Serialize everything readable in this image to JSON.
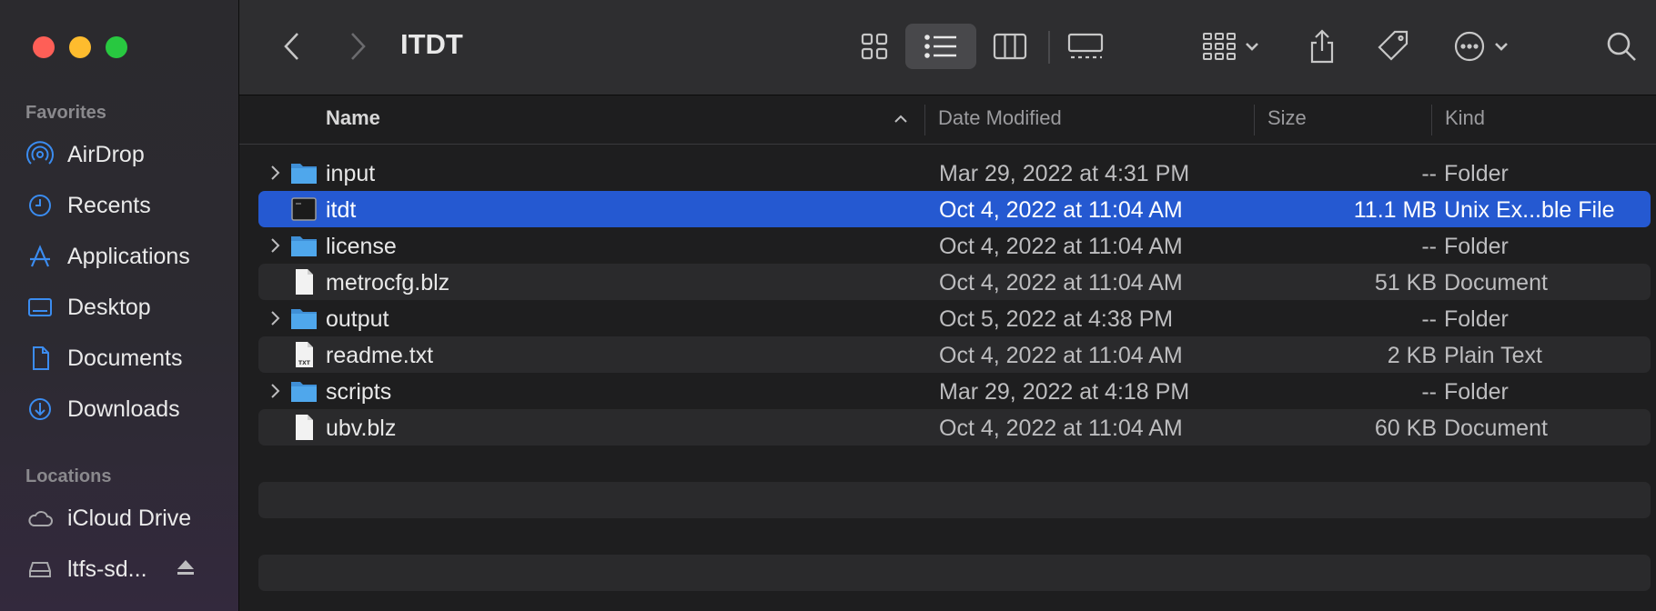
{
  "window": {
    "title": "ITDT"
  },
  "sidebar": {
    "favorites_heading": "Favorites",
    "favorites": [
      {
        "label": "AirDrop",
        "icon": "airdrop-icon"
      },
      {
        "label": "Recents",
        "icon": "clock-icon"
      },
      {
        "label": "Applications",
        "icon": "applications-icon"
      },
      {
        "label": "Desktop",
        "icon": "desktop-icon"
      },
      {
        "label": "Documents",
        "icon": "document-icon"
      },
      {
        "label": "Downloads",
        "icon": "download-icon"
      }
    ],
    "locations_heading": "Locations",
    "locations": [
      {
        "label": "iCloud Drive",
        "icon": "cloud-icon"
      },
      {
        "label": "ltfs-sd...",
        "icon": "drive-icon",
        "ejectable": true
      }
    ]
  },
  "columns": {
    "name": "Name",
    "date": "Date Modified",
    "size": "Size",
    "kind": "Kind"
  },
  "files": [
    {
      "name": "input",
      "date": "Mar 29, 2022 at 4:31 PM",
      "size": "--",
      "kind": "Folder",
      "type": "folder"
    },
    {
      "name": "itdt",
      "date": "Oct 4, 2022 at 11:04 AM",
      "size": "11.1 MB",
      "kind": "Unix Ex...ble File",
      "type": "exec",
      "selected": true
    },
    {
      "name": "license",
      "date": "Oct 4, 2022 at 11:04 AM",
      "size": "--",
      "kind": "Folder",
      "type": "folder"
    },
    {
      "name": "metrocfg.blz",
      "date": "Oct 4, 2022 at 11:04 AM",
      "size": "51 KB",
      "kind": "Document",
      "type": "doc"
    },
    {
      "name": "output",
      "date": "Oct 5, 2022 at 4:38 PM",
      "size": "--",
      "kind": "Folder",
      "type": "folder"
    },
    {
      "name": "readme.txt",
      "date": "Oct 4, 2022 at 11:04 AM",
      "size": "2 KB",
      "kind": "Plain Text",
      "type": "txt"
    },
    {
      "name": "scripts",
      "date": "Mar 29, 2022 at 4:18 PM",
      "size": "--",
      "kind": "Folder",
      "type": "folder"
    },
    {
      "name": "ubv.blz",
      "date": "Oct 4, 2022 at 11:04 AM",
      "size": "60 KB",
      "kind": "Document",
      "type": "doc"
    }
  ],
  "colors": {
    "accent": "#2559d1",
    "sidebar_icon": "#3b8cf0",
    "folder": "#4fa7ec"
  }
}
